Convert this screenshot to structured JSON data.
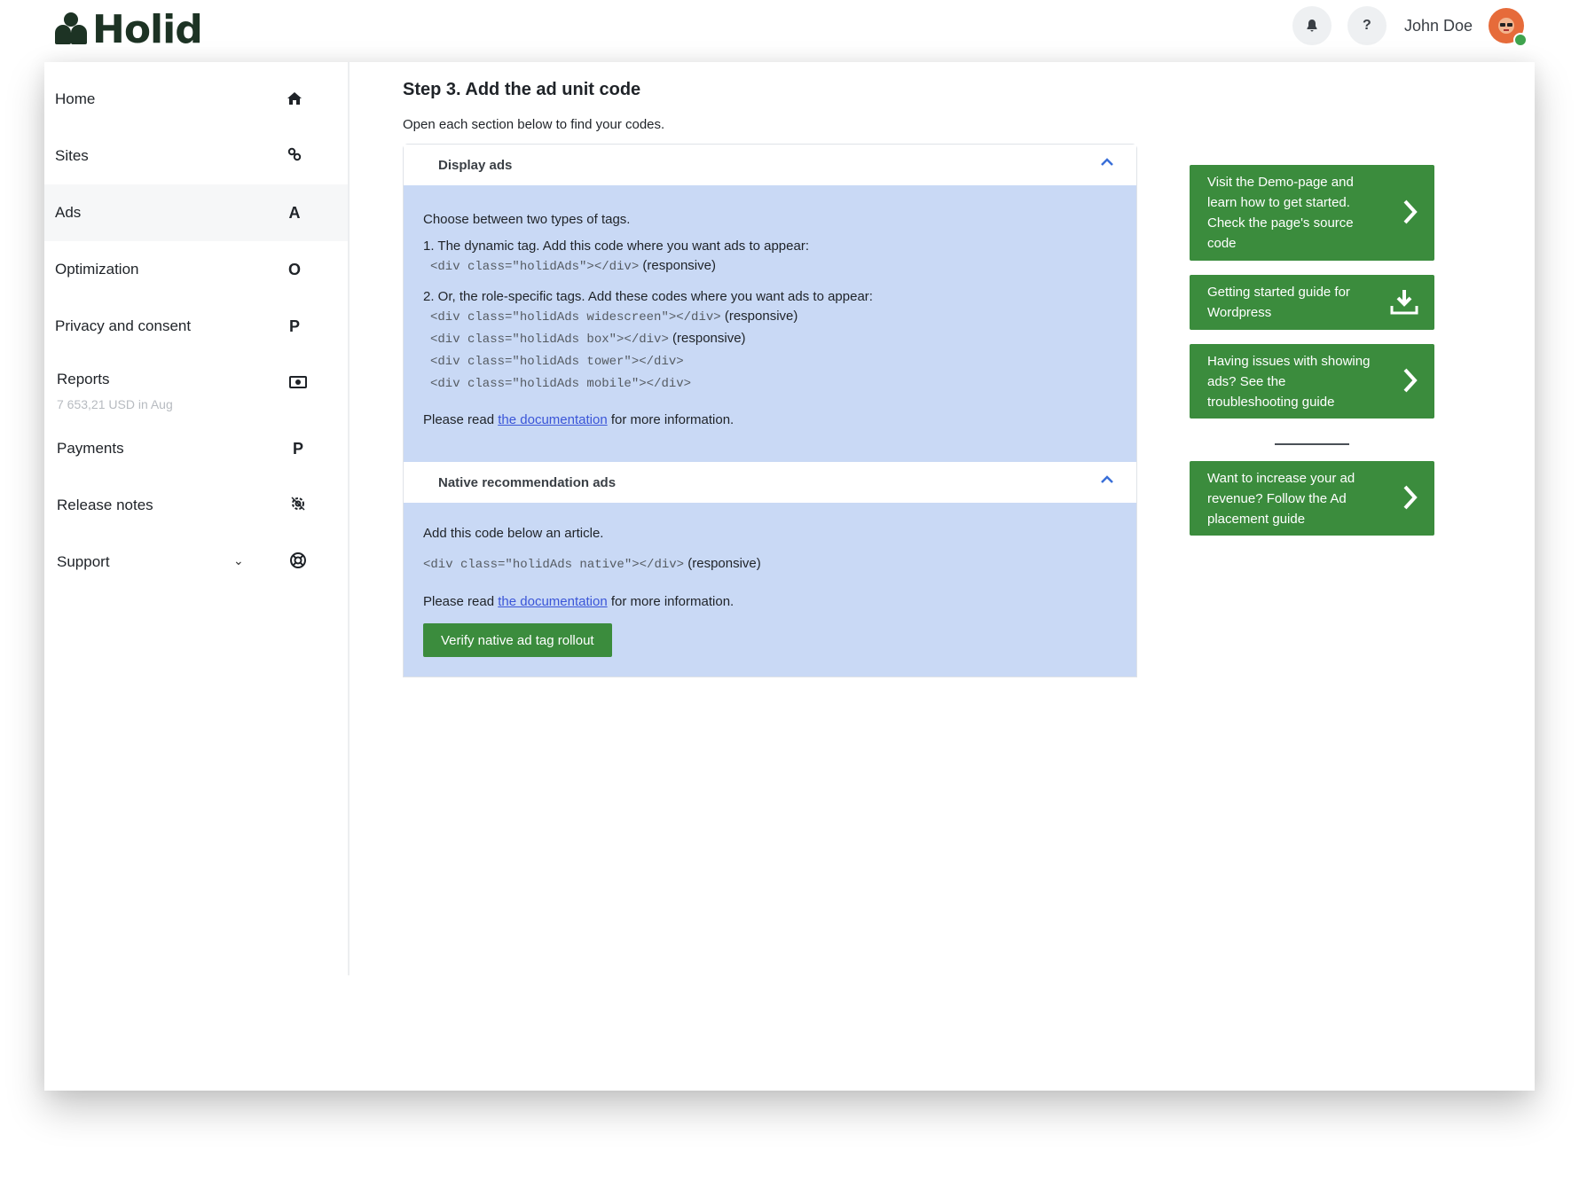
{
  "brand": {
    "name": "Holid"
  },
  "header": {
    "notifications_icon": "bell-icon",
    "help_label": "?",
    "user_name": "John Doe",
    "avatar_icon": "avatar-face-icon",
    "status_color": "#3fa34d"
  },
  "sidebar": {
    "items": [
      {
        "label": "Home",
        "icon": "home-icon",
        "glyph": "⌂"
      },
      {
        "label": "Sites",
        "icon": "link-icon",
        "glyph": "⚭"
      },
      {
        "label": "Ads",
        "icon": "letter-a-icon",
        "glyph": "A",
        "active": true
      },
      {
        "label": "Optimization",
        "icon": "letter-o-icon",
        "glyph": "O"
      },
      {
        "label": "Privacy and consent",
        "icon": "letter-p-icon",
        "glyph": "P"
      },
      {
        "label": "Reports",
        "sub": "7 653,21 USD in Aug",
        "icon": "money-icon",
        "glyph": "▣"
      },
      {
        "label": "Payments",
        "icon": "letter-p-icon",
        "glyph": "P"
      },
      {
        "label": "Release notes",
        "icon": "gear-icon",
        "glyph": "⚙"
      },
      {
        "label": "Support",
        "icon": "lifebuoy-icon",
        "glyph": "⊛",
        "chevron": "⌄"
      }
    ]
  },
  "main": {
    "title": "Step 3. Add the ad unit code",
    "subtitle": "Open each section below to find your codes.",
    "display_ads": {
      "header": "Display ads",
      "intro": "Choose between two types of tags.",
      "item1": "1. The dynamic tag. Add this code where you want ads to appear:",
      "item1_code": "<div class=\"holidAds\"></div>",
      "item1_suffix": "(responsive)",
      "item2": "2. Or, the role-specific tags. Add these codes where you want ads to appear:",
      "codes": [
        {
          "code": "<div class=\"holidAds widescreen\"></div>",
          "suffix": "(responsive)"
        },
        {
          "code": "<div class=\"holidAds box\"></div>",
          "suffix": "(responsive)"
        },
        {
          "code": "<div class=\"holidAds tower\"></div>",
          "suffix": ""
        },
        {
          "code": "<div class=\"holidAds mobile\"></div>",
          "suffix": ""
        }
      ],
      "read_prefix": "Please read",
      "read_link": "the documentation",
      "read_suffix": "for more information."
    },
    "native_ads": {
      "header": "Native recommendation ads",
      "intro": "Add this code below an article.",
      "code": "<div class=\"holidAds native\"></div>",
      "code_suffix": "(responsive)",
      "read_prefix": "Please read",
      "read_link": "the documentation",
      "read_suffix": "for more information.",
      "button": "Verify native ad tag rollout"
    }
  },
  "cards": [
    {
      "text": "Visit the Demo-page and learn how to get started. Check the page's source code",
      "icon": "chevron-right-icon"
    },
    {
      "text": "Getting started guide for Wordpress",
      "icon": "download-icon"
    },
    {
      "text": "Having issues with showing ads? See the troubleshooting guide",
      "icon": "chevron-right-icon"
    },
    {
      "text": "Want to increase your ad revenue? Follow the Ad placement guide",
      "icon": "chevron-right-icon"
    }
  ],
  "colors": {
    "accent_green": "#3b8c3d",
    "panel_blue": "#c9d9f5",
    "link_blue": "#3a55d8",
    "brand_dark": "#1d3324"
  }
}
